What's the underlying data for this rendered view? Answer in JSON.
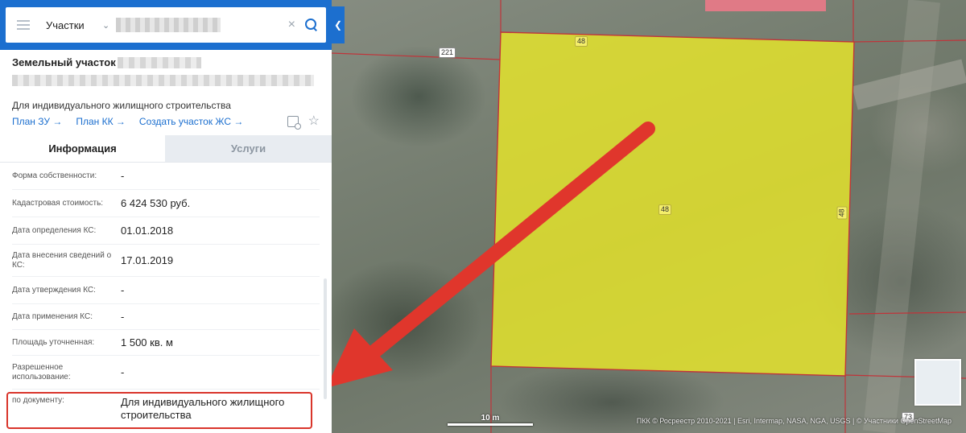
{
  "search": {
    "type_label": "Участки",
    "clear_symbol": "×"
  },
  "parcel": {
    "title": "Земельный участок",
    "purpose": "Для индивидуального жилищного строительства",
    "links": [
      {
        "label": "План ЗУ →"
      },
      {
        "label": "План КК →"
      },
      {
        "label": "Создать участок ЖС →"
      }
    ]
  },
  "tabs": [
    {
      "label": "Информация",
      "active": true
    },
    {
      "label": "Услуги",
      "active": false
    }
  ],
  "info_rows": [
    {
      "label": "Форма собственности:",
      "value": "-"
    },
    {
      "label": "Кадастровая стоимость:",
      "value": "6 424 530 руб."
    },
    {
      "label": "Дата определения КС:",
      "value": "01.01.2018"
    },
    {
      "label": "Дата внесения сведений о КС:",
      "value": "17.01.2019"
    },
    {
      "label": "Дата утверждения КС:",
      "value": "-"
    },
    {
      "label": "Дата применения КС:",
      "value": "-"
    },
    {
      "label": "Площадь уточненная:",
      "value": "1 500 кв. м"
    },
    {
      "label": "Разрешенное использование:",
      "value": "-"
    },
    {
      "label": "по документу:",
      "value": "Для индивидуального жилищного строительства"
    }
  ],
  "map": {
    "scale_label": "10 m",
    "attribution": "ПКК © Росреестр 2010-2021 | Esri, Intermap, NASA, NGA, USGS | © Участники OpenStreetMap",
    "parcel_labels": [
      {
        "text": "221"
      },
      {
        "text": "48"
      },
      {
        "text": "48"
      },
      {
        "text": "48"
      },
      {
        "text": "73"
      }
    ],
    "colors": {
      "parcel_fill": "#e8e62a",
      "boundary": "#c0343a",
      "arrow": "#e0362c",
      "accent": "#1c6fcf"
    }
  }
}
